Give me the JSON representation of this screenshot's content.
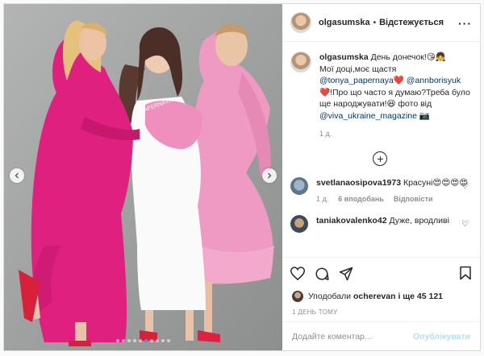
{
  "photo": {
    "dots_total": 10,
    "dots_active_index": 5,
    "dress_text": "PAPERNAYA"
  },
  "header": {
    "username": "olgasumska",
    "separator": "•",
    "follow_status": "Відстежується"
  },
  "caption": {
    "username": "olgasumska",
    "text_1": "День донечок!😘👧",
    "text_2": "Мої доці,моє щастя",
    "mention_1": "@tonya_papernaya",
    "heart_1": "❤️",
    "mention_2": "@annborisyuk",
    "text_3": "❤️!Про що часто я думаю?Треба було ще народжувати!😆 фото від",
    "mention_3": "@viva_ukraine_magazine",
    "text_4": "📷",
    "age": "1 д."
  },
  "load_more": "+",
  "comments": [
    {
      "username": "svetlanaosipova1973",
      "text": "Красуні😍😍😍😍",
      "age": "1 д.",
      "likes": "6 вподобань",
      "reply": "Відповісти"
    },
    {
      "username": "taniakovalenko42",
      "text": "Дуже, вродливі"
    }
  ],
  "likes": {
    "prefix": "Уподобали",
    "first_user": "ocherevan",
    "and_more": "і ще 45 121"
  },
  "timestamp": "1 ДЕНЬ ТОМУ",
  "add_comment": {
    "placeholder": "Додайте коментар...",
    "publish": "Опублікувати"
  },
  "colors": {
    "magenta_dress": "#e0207e",
    "pink_dress": "#ee9ac2",
    "background": "#a5a6a6",
    "link": "#00376b",
    "publish_disabled": "#b2dffc"
  }
}
